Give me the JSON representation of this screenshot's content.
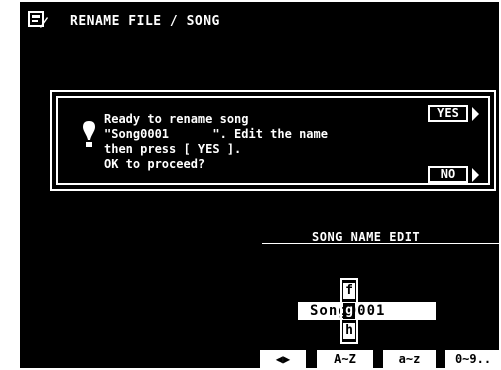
{
  "header": {
    "title": "RENAME FILE / SONG",
    "icon": "file-edit-icon"
  },
  "dialog": {
    "icon": "exclamation-icon",
    "lines": [
      "Ready to rename song",
      "\"Song0001      \". Edit the name",
      "then press [ YES ].",
      "OK to proceed?"
    ],
    "yes_label": "YES",
    "no_label": "NO"
  },
  "name_edit": {
    "title": "SONG NAME EDIT",
    "value": "Song0001",
    "prev_char": "f",
    "current_char": "g",
    "next_char": "h"
  },
  "bottom_tabs": {
    "cursor": "◀▶",
    "uppercase": "A~Z",
    "lowercase": "a~z",
    "numbers": "0~9.."
  },
  "colors": {
    "background": "#000000",
    "foreground": "#ffffff"
  }
}
